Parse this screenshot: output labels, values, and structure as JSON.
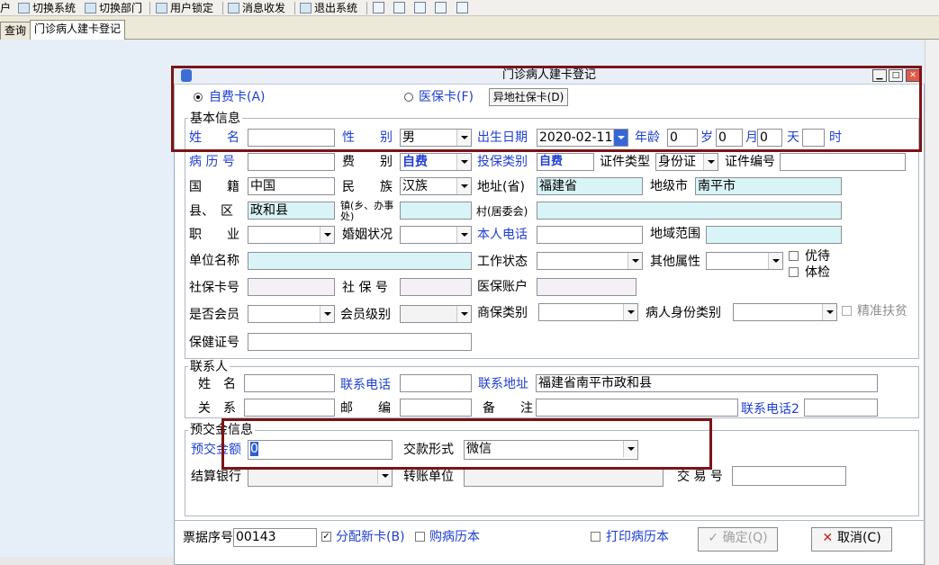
{
  "toolbar": {
    "partial_label": "户",
    "switch_system": "切换系统",
    "switch_dept": "切换部门",
    "user_lock": "用户锁定",
    "message": "消息收发",
    "exit": "退出系统"
  },
  "tabs": [
    {
      "label": "查询"
    },
    {
      "label": "门诊病人建卡登记"
    }
  ],
  "window": {
    "title": "门诊病人建卡登记",
    "min": "▁",
    "max": "□",
    "close": "✕"
  },
  "payment_type": {
    "self_pay": "自费卡(A)",
    "insurance": "医保卡(F)",
    "remote_btn": "异地社保卡(D)"
  },
  "basic": {
    "section": "基本信息",
    "name_label": "姓　　名",
    "name": "",
    "sex_label": "性　　别",
    "sex": "男",
    "dob_label": "出生日期",
    "dob": "2020-02-11",
    "age_label": "年龄",
    "age_years": "0",
    "years_unit": "岁",
    "age_months": "0",
    "months_unit": "月",
    "age_days": "0",
    "days_unit": "天",
    "age_hours": "",
    "hours_unit": "时",
    "record_label": "病 历 号",
    "record": "",
    "fee_label": "费　　别",
    "fee": "自费",
    "insure_type_label": "投保类别",
    "insure_type": "自费",
    "id_type_label": "证件类型",
    "id_type": "身份证",
    "id_no_label": "证件编号",
    "id_no": "",
    "nation_label": "国　　籍",
    "nation": "中国",
    "ethnic_label": "民　　族",
    "ethnic": "汉族",
    "province_label": "地址(省)",
    "province": "福建省",
    "city_label": "地级市",
    "city": "南平市",
    "county_label": "县、　区",
    "county": "政和县",
    "town_label": "镇(乡、办事处)",
    "town": "",
    "village_label": "村(居委会)",
    "village": "",
    "job_label": "职　　业",
    "job": "",
    "marital_label": "婚姻状况",
    "marital": "",
    "phone_label": "本人电话",
    "phone": "",
    "area_label": "地域范围",
    "area": "",
    "employer_label": "单位名称",
    "employer": "",
    "work_label": "工作状态",
    "work": "",
    "other_label": "其他属性",
    "other": "",
    "priority_label": "优待",
    "checkup_label": "体检",
    "ssn_label": "社保卡号",
    "ssn": "",
    "sino_label": "社 保 号",
    "sino": "",
    "medacct_label": "医保账户",
    "medacct": "",
    "member_label": "是否会员",
    "member": "",
    "member_level_label": "会员级别",
    "member_level": "",
    "commercial_label": "商保类别",
    "commercial": "",
    "patient_type_label": "病人身份类别",
    "patient_type": "",
    "poverty_label": "精准扶贫",
    "health_label": "保健证号",
    "health": ""
  },
  "contact": {
    "section": "联系人",
    "name_label": "姓　名",
    "name": "",
    "phone_label": "联系电话",
    "phone": "",
    "addr_label": "联系地址",
    "addr": "福建省南平市政和县",
    "relation_label": "关　系",
    "relation": "",
    "zip_label": "邮　　编",
    "zip": "",
    "remark_label": "备　　注",
    "remark": "",
    "phone2_label": "联系电话2",
    "phone2": ""
  },
  "deposit": {
    "section": "预交金信息",
    "amount_label": "预交金额",
    "amount": "0",
    "method_label": "交款形式",
    "method": "微信",
    "bank_label": "结算银行",
    "bank": "",
    "transfer_label": "转账单位",
    "transfer": "",
    "trade_label": "交 易 号",
    "trade": ""
  },
  "footer": {
    "receipt_label": "票据序号",
    "receipt": "00143",
    "new_card": "分配新卡(B)",
    "buy_book": "购病历本",
    "print_book": "打印病历本",
    "ok": "确定(Q)",
    "cancel": "取消(C)"
  },
  "colors": {
    "blue_label": "#1f3fd0",
    "highlight_box": "#7a1418",
    "field_cyan": "#d9f4f7"
  }
}
